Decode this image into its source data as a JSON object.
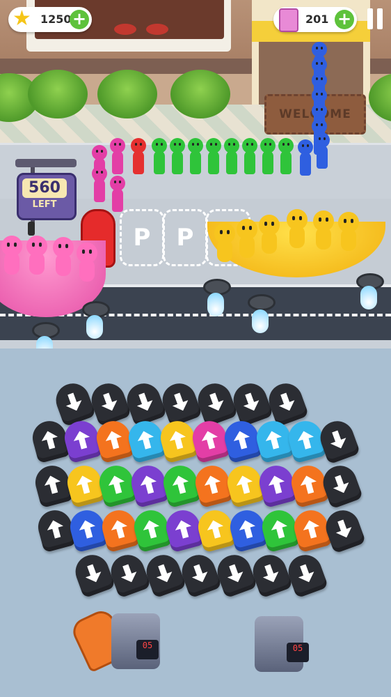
{
  "hud": {
    "stars": "1250",
    "tickets": "201",
    "icons": [
      "star-icon",
      "plus-icon",
      "ticket-icon",
      "pause-icon"
    ]
  },
  "scene": {
    "welcome_mat": "WELCOME",
    "sign_number": "560",
    "sign_label": "LEFT",
    "parking_letter": "P"
  },
  "counters": {
    "left": "05",
    "right": "05"
  },
  "colors": {
    "yellow": "#f7c51e",
    "pink": "#ff6fbe",
    "green": "#2fc43a",
    "blue": "#2f5fe0",
    "purple": "#7b3fd0",
    "orange": "#f4731e",
    "red": "#e53030",
    "cyan": "#35b6ec",
    "magenta": "#e33ea6",
    "black": "#2b2d33"
  }
}
